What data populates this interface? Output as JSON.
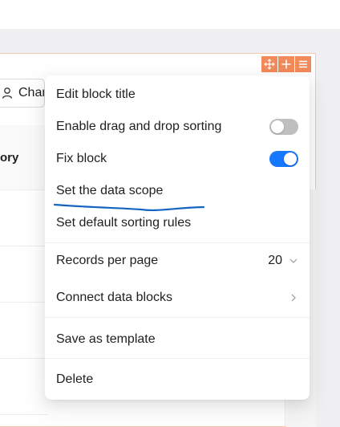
{
  "background": {
    "search_chip_text": "Chan",
    "table_header_text": "ory"
  },
  "block_tools": {
    "icons": [
      "drag-icon",
      "add-icon",
      "settings-menu-icon"
    ],
    "color": "#f28b5b"
  },
  "menu": {
    "items": [
      {
        "label": "Edit block title"
      },
      {
        "label": "Enable drag and drop sorting",
        "toggle": false
      },
      {
        "label": "Fix block",
        "toggle": true
      },
      {
        "label": "Set the data scope"
      },
      {
        "label": "Set default sorting rules"
      },
      {
        "label": "Records per page",
        "value": "20"
      },
      {
        "label": "Connect data blocks"
      },
      {
        "label": "Save as template"
      },
      {
        "label": "Delete"
      }
    ]
  },
  "colors": {
    "accent": "#1677ff",
    "toggle_off": "#bfbfbf",
    "annotation": "#1565c0"
  }
}
